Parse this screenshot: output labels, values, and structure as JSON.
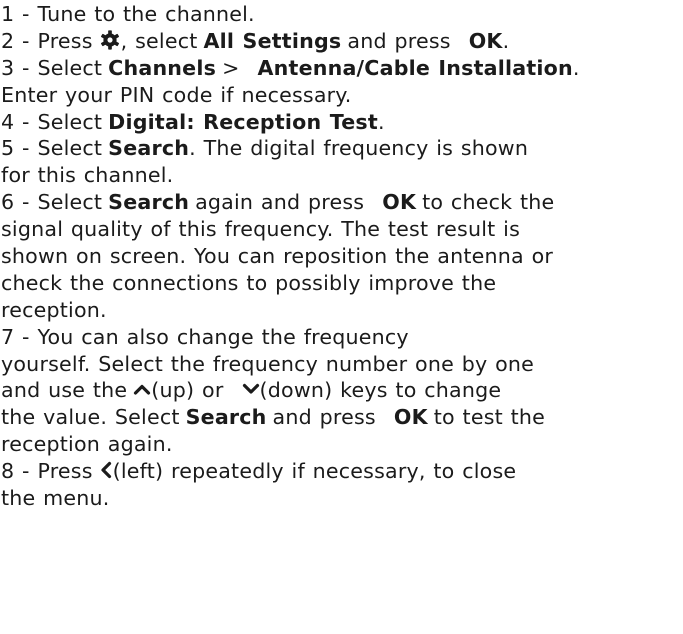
{
  "steps": {
    "s1": {
      "num": "1 - ",
      "text": "Tune to the channel."
    },
    "s2": {
      "num": "2 - ",
      "press": "Press",
      "icon": "gear-icon",
      "mid": ", select",
      "all_settings": "All Settings",
      "and_press": "and press",
      "ok": "OK",
      "end": "."
    },
    "s3": {
      "num": "3 - ",
      "select": "Select",
      "channels": "Channels",
      "sep": ">",
      "antenna": "Antenna/Cable Installation",
      "end": ".",
      "line2": "Enter your PIN code if necessary."
    },
    "s4": {
      "num": "4 - ",
      "select": "Select",
      "digital": "Digital: Reception Test",
      "end": "."
    },
    "s5": {
      "num": "5 - ",
      "select": "Select",
      "search": "Search",
      "rest": ". The digital frequency is shown",
      "line2": "for this channel."
    },
    "s6": {
      "num": "6 - ",
      "select": "Select",
      "search": "Search",
      "again": "again and press",
      "ok": "OK",
      "rest": "to check the",
      "line2": "signal quality of this frequency. The test result is",
      "line3": "shown on screen. You can reposition the antenna or",
      "line4": "check the connections to possibly improve the",
      "line5": "reception."
    },
    "s7": {
      "num": "7 - ",
      "text": "You can also change the frequency",
      "line2": "yourself. Select the frequency number one by one",
      "line3a": "and use the",
      "up_icon": "chevron-up-icon",
      "up": "(up) or",
      "down_icon": "chevron-down-icon",
      "down": "(down) keys to change",
      "line4a": "the value. Select",
      "search": "Search",
      "and_press": "and press",
      "ok": "OK",
      "line4b": "to test the",
      "line5": "reception again."
    },
    "s8": {
      "num": "8 - ",
      "press": "Press",
      "left_icon": "chevron-left-icon",
      "rest": "(left) repeatedly if necessary, to close",
      "line2": "the menu."
    }
  }
}
